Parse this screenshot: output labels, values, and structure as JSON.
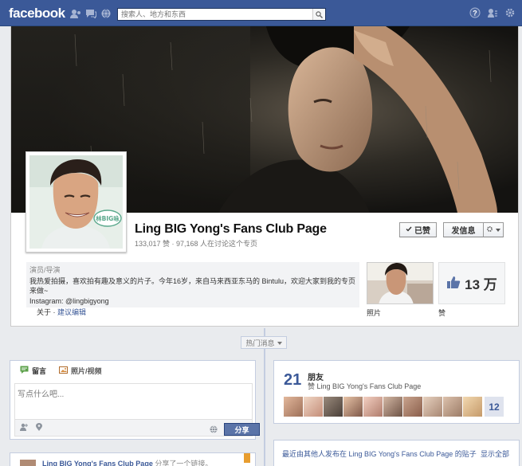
{
  "topbar": {
    "logo": "facebook",
    "search_placeholder": "搜索人、地方和东西"
  },
  "page": {
    "name": "Ling BIG Yong's Fans Club Page",
    "stats": "133,017 赞 · 97,168 人在讨论这个专页",
    "profile_badge": "林BIG咏"
  },
  "actions": {
    "liked_label": "已赞",
    "message_label": "发信息"
  },
  "about": {
    "category": "演员/导演",
    "text": "我热爱拍摄，喜欢拍有趣及意义的片子。今年16岁，来自马来西亚东马的 Bintulu，欢迎大家到我的专页来做~",
    "instagram": "Instagram: @lingbigyong",
    "link_prefix": "关于 · ",
    "link_label": "建议编辑"
  },
  "photos": {
    "label": "照片"
  },
  "likes": {
    "count": "13 万",
    "label": "赞"
  },
  "timeline": {
    "filter_label": "热门消息"
  },
  "composer": {
    "tab_post": "留言",
    "tab_photo": "照片/视频",
    "placeholder": "写点什么吧...",
    "post_button": "分享"
  },
  "friends": {
    "count": "21",
    "title": "朋友",
    "subtitle": "赞 Ling BIG Yong's Fans Club Page",
    "more": "12"
  },
  "recent": {
    "text": "最近由其他人发布在 Ling BIG Yong's Fans Club Page 的贴子",
    "show_all": "显示全部"
  },
  "post_teaser": {
    "author": "Ling BIG Yong's Fans Club Page",
    "action": " 分享了一个链接。"
  },
  "colors": {
    "brand": "#3b5998",
    "panel": "#f2f3f5",
    "bookmark": "#e89d2f"
  }
}
